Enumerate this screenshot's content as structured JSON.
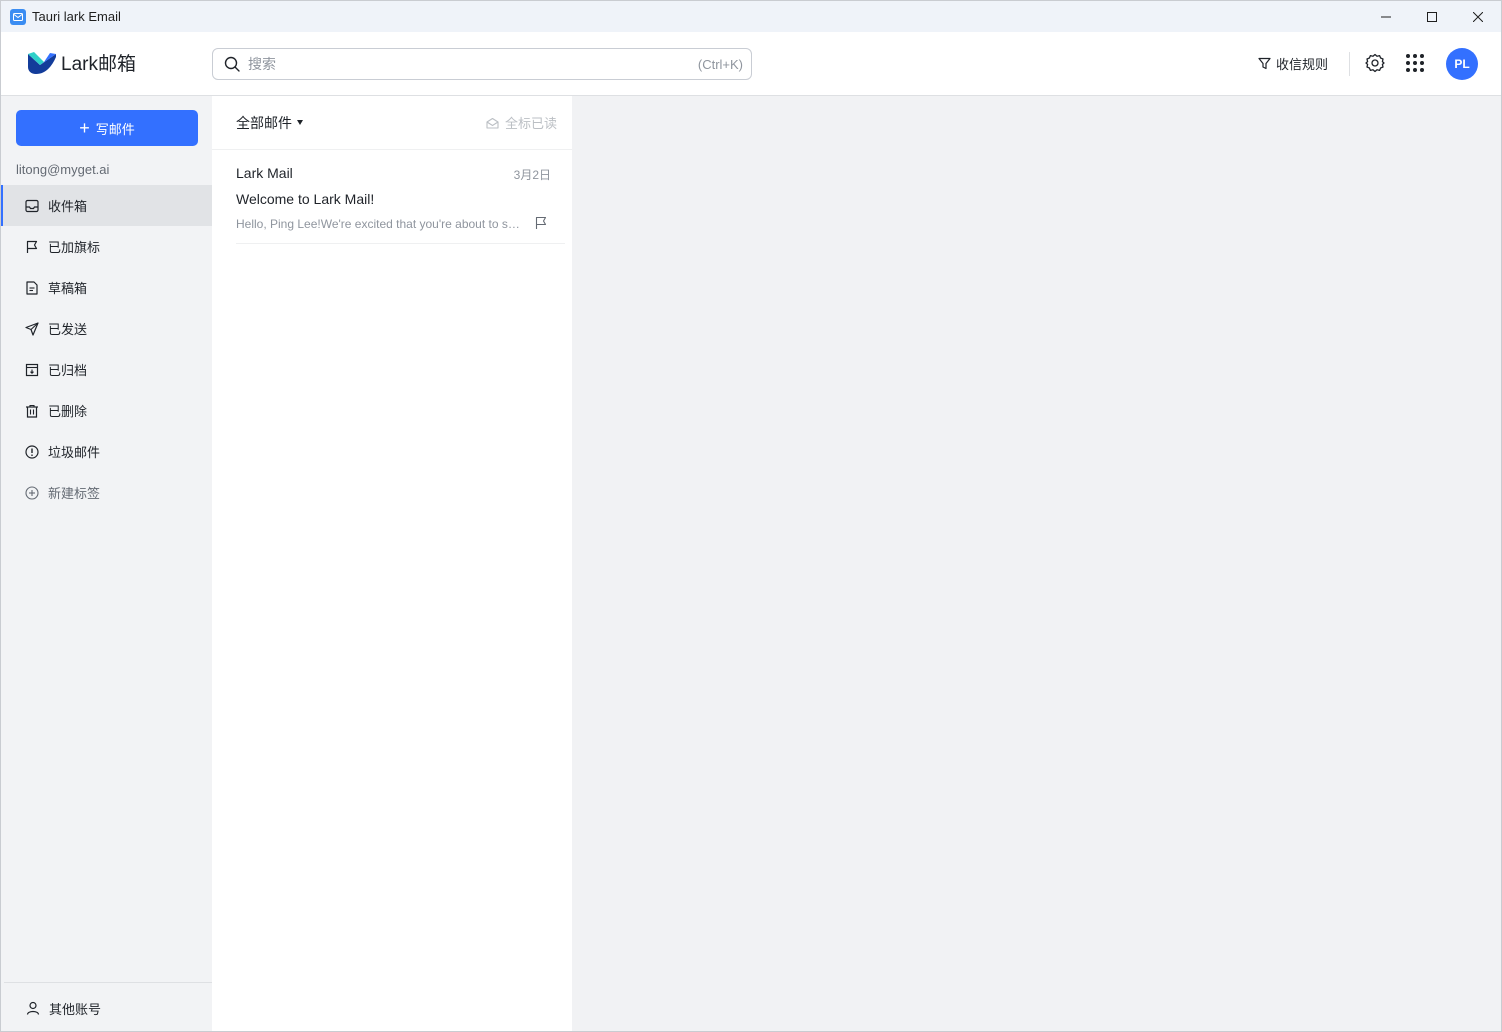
{
  "window": {
    "title": "Tauri lark Email"
  },
  "header": {
    "logo_text": "Lark邮箱",
    "search": {
      "placeholder": "搜索",
      "shortcut": "(Ctrl+K)"
    },
    "rules_label": "收信规则",
    "avatar_initials": "PL"
  },
  "sidebar": {
    "compose_label": "写邮件",
    "account_email": "litong@myget.ai",
    "items": [
      {
        "label": "收件箱",
        "icon": "inbox-icon",
        "active": true
      },
      {
        "label": "已加旗标",
        "icon": "flag-icon"
      },
      {
        "label": "草稿箱",
        "icon": "draft-icon"
      },
      {
        "label": "已发送",
        "icon": "send-icon"
      },
      {
        "label": "已归档",
        "icon": "archive-icon"
      },
      {
        "label": "已删除",
        "icon": "trash-icon"
      },
      {
        "label": "垃圾邮件",
        "icon": "spam-icon"
      },
      {
        "label": "新建标签",
        "icon": "add-label-icon"
      }
    ],
    "other_accounts_label": "其他账号"
  },
  "mail_list": {
    "filter_label": "全部邮件",
    "mark_all_read_label": "全标已读",
    "messages": [
      {
        "sender": "Lark Mail",
        "date": "3月2日",
        "subject": "Welcome to Lark Mail!",
        "preview": "Hello, Ping Lee!We're excited that you're about to start using Lark Mail"
      }
    ]
  },
  "colors": {
    "accent": "#3370ff",
    "sidebar_bg": "#f2f3f5",
    "reading_bg": "#f1f2f4"
  }
}
